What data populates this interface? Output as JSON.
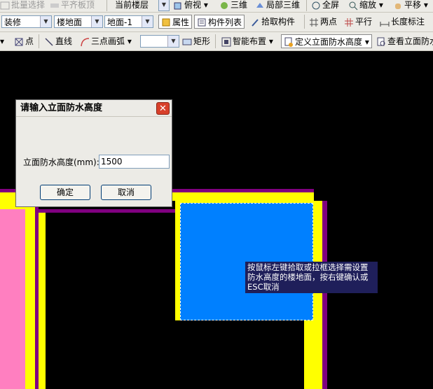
{
  "toolbar1": {
    "batch_select": "批量选择",
    "align_board_top": "平齐板顶",
    "current_floor": "当前楼层",
    "top_view": "俯视",
    "three_d": "三维",
    "local_three_d": "局部三维",
    "full_screen": "全屏",
    "zoom": "缩放",
    "pan": "平移"
  },
  "toolbar2": {
    "category_select": "装修",
    "type_select": "楼地面",
    "component_select": "地面-1",
    "properties": "属性",
    "component_list": "构件列表",
    "pick_component": "拾取构件",
    "two_points": "两点",
    "parallel": "平行",
    "length_dimension": "长度标注"
  },
  "toolbar3": {
    "point": "点",
    "line": "直线",
    "three_point_arc": "三点画弧",
    "rectangle": "矩形",
    "smart_layout": "智能布置",
    "define_wall_waterproof_height": "定义立面防水高度",
    "view_wall_waterproof": "查看立面防水"
  },
  "dialog": {
    "title": "请输入立面防水高度",
    "field_label": "立面防水高度(mm):",
    "field_value": "1500",
    "ok": "确定",
    "cancel": "取消"
  },
  "tooltip": {
    "line1": "按鼠标左键拾取或拉框选择需设置",
    "line2": "防水高度的楼地面，按右键确认或",
    "line3": "ESC取消"
  },
  "colors": {
    "background": "#000000",
    "wall_yellow": "#ffff00",
    "wall_purple": "#800080",
    "pink_area": "#ff7fc0",
    "floor_blue": "#0080ff"
  }
}
